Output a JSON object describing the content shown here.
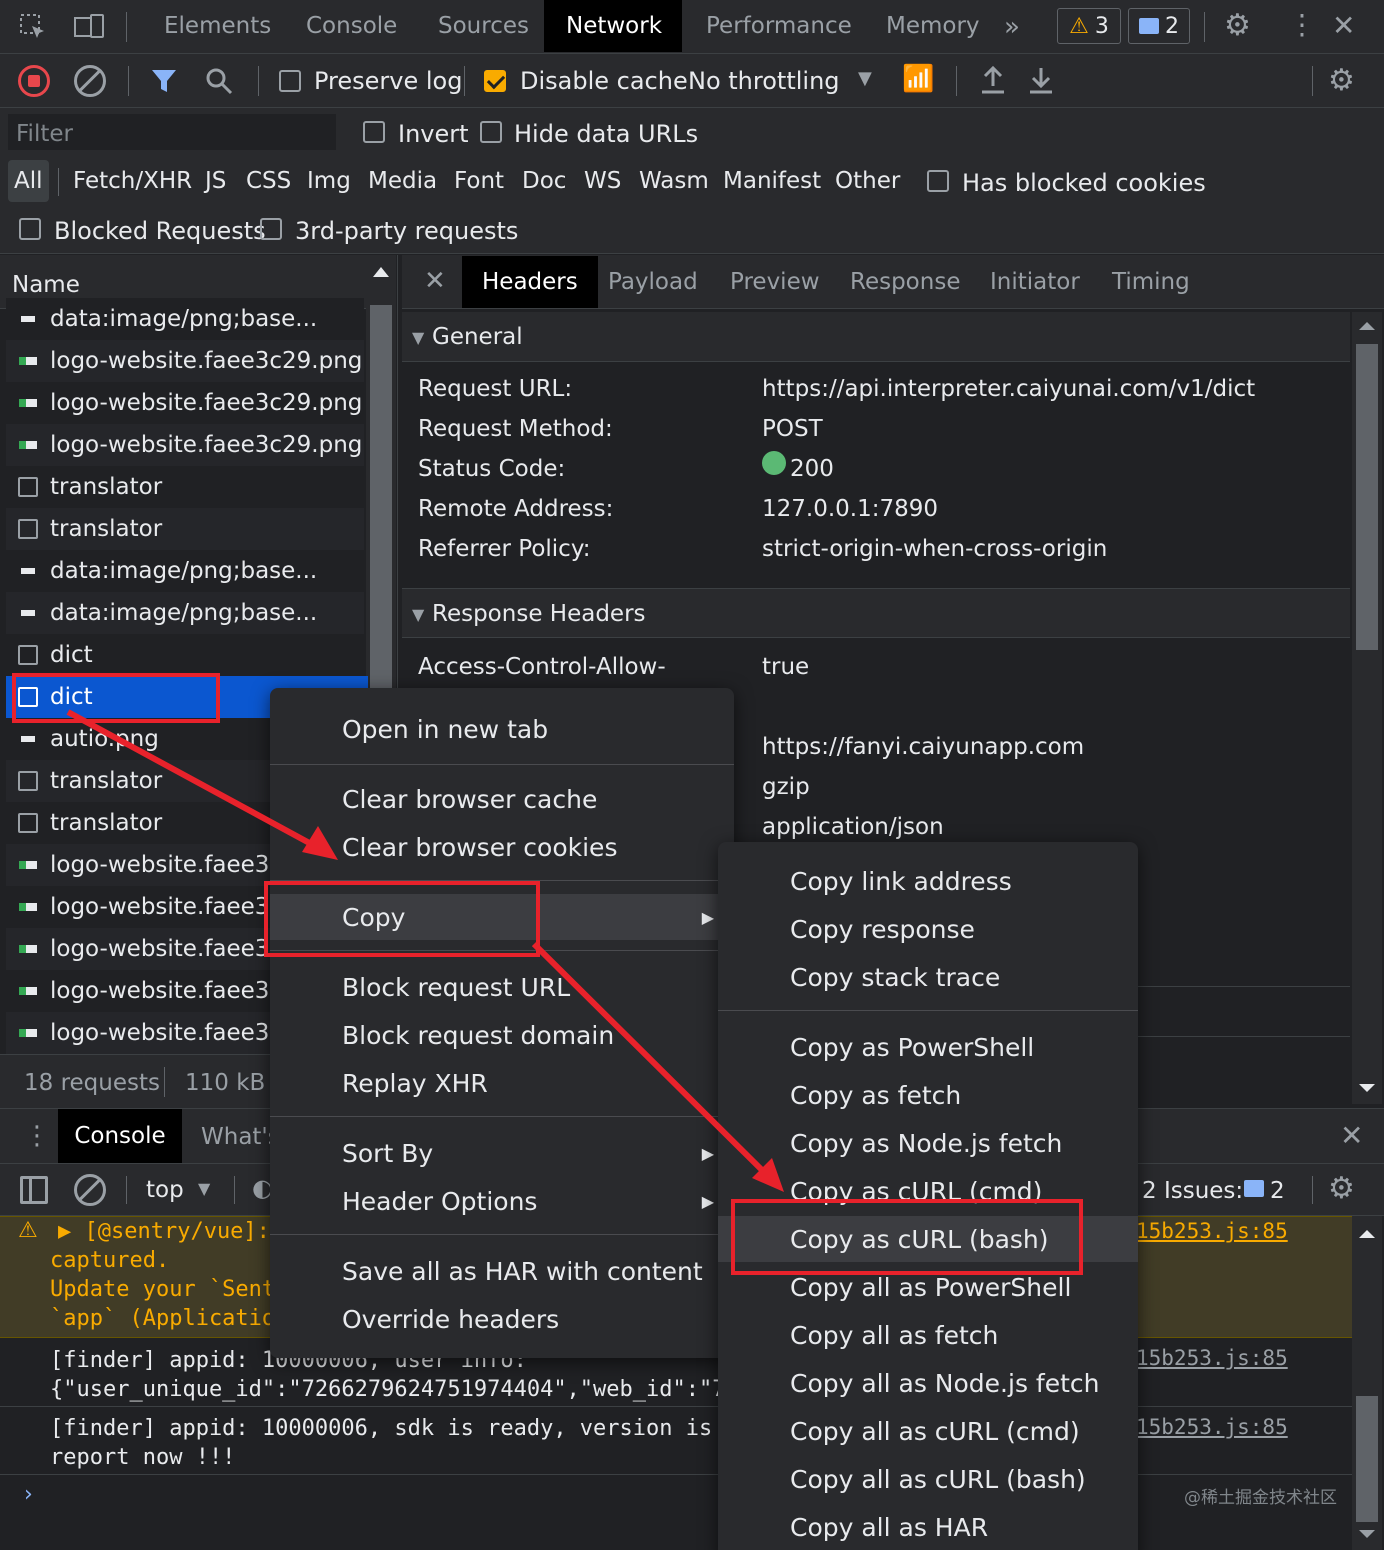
{
  "top_tabs": [
    "Elements",
    "Console",
    "Sources",
    "Network",
    "Performance",
    "Memory"
  ],
  "top_badges": {
    "warnings": "3",
    "messages": "2"
  },
  "toolbar": {
    "preserve_log": "Preserve log",
    "disable_cache": "Disable cache",
    "throttling": "No throttling"
  },
  "filter": {
    "placeholder": "Filter",
    "invert": "Invert",
    "hide_data_urls": "Hide data URLs",
    "has_blocked_cookies": "Has blocked cookies",
    "blocked_requests": "Blocked Requests",
    "third_party": "3rd-party requests"
  },
  "type_filters": [
    "All",
    "Fetch/XHR",
    "JS",
    "CSS",
    "Img",
    "Media",
    "Font",
    "Doc",
    "WS",
    "Wasm",
    "Manifest",
    "Other"
  ],
  "request_list": {
    "header": "Name",
    "rows": [
      {
        "name": "data:image/png;base...",
        "icon": "image-icon"
      },
      {
        "name": "logo-website.faee3c29.png",
        "icon": "png-icon"
      },
      {
        "name": "logo-website.faee3c29.png",
        "icon": "png-icon"
      },
      {
        "name": "logo-website.faee3c29.png",
        "icon": "png-icon"
      },
      {
        "name": "translator",
        "icon": "document-icon"
      },
      {
        "name": "translator",
        "icon": "document-icon"
      },
      {
        "name": "data:image/png;base...",
        "icon": "image-icon"
      },
      {
        "name": "data:image/png;base...",
        "icon": "image-icon"
      },
      {
        "name": "dict",
        "icon": "document-icon"
      },
      {
        "name": "dict",
        "icon": "document-icon"
      },
      {
        "name": "autio.png",
        "icon": "image-icon"
      },
      {
        "name": "translator",
        "icon": "document-icon"
      },
      {
        "name": "translator",
        "icon": "document-icon"
      },
      {
        "name": "logo-website.faee3c29.png",
        "icon": "png-icon"
      },
      {
        "name": "logo-website.faee3c29.png",
        "icon": "png-icon"
      },
      {
        "name": "logo-website.faee3c29.png",
        "icon": "png-icon"
      },
      {
        "name": "logo-website.faee3c29.png",
        "icon": "png-icon"
      },
      {
        "name": "logo-website.faee3c29.png",
        "icon": "png-icon"
      }
    ],
    "summary_requests": "18 requests",
    "summary_size": "110 kB t"
  },
  "detail_tabs": [
    "Headers",
    "Payload",
    "Preview",
    "Response",
    "Initiator",
    "Timing"
  ],
  "general": {
    "title": "General",
    "rows": [
      {
        "key": "Request URL:",
        "value": "https://api.interpreter.caiyunai.com/v1/dict"
      },
      {
        "key": "Request Method:",
        "value": "POST"
      },
      {
        "key": "Status Code:",
        "value": "200"
      },
      {
        "key": "Remote Address:",
        "value": "127.0.0.1:7890"
      },
      {
        "key": "Referrer Policy:",
        "value": "strict-origin-when-cross-origin"
      }
    ]
  },
  "response_headers": {
    "title": "Response Headers",
    "first_key": "Access-Control-Allow-",
    "values": [
      "true",
      "https://fanyi.caiyunapp.com",
      "gzip",
      "application/json"
    ]
  },
  "context_menu": {
    "group1": [
      "Open in new tab"
    ],
    "group2": [
      "Clear browser cache",
      "Clear browser cookies"
    ],
    "group3": [
      "Copy"
    ],
    "group4": [
      "Block request URL",
      "Block request domain",
      "Replay XHR"
    ],
    "group5": [
      "Sort By",
      "Header Options"
    ],
    "group6": [
      "Save all as HAR with content",
      "Override headers"
    ]
  },
  "copy_submenu": {
    "group1": [
      "Copy link address",
      "Copy response",
      "Copy stack trace"
    ],
    "group2": [
      "Copy as PowerShell",
      "Copy as fetch",
      "Copy as Node.js fetch",
      "Copy as cURL (cmd)",
      "Copy as cURL (bash)",
      "Copy all as PowerShell",
      "Copy all as fetch",
      "Copy all as Node.js fetch",
      "Copy all as cURL (cmd)",
      "Copy all as cURL (bash)",
      "Copy all as HAR"
    ]
  },
  "drawer": {
    "tabs": [
      "Console",
      "What's"
    ],
    "context": "top",
    "issues_label": "2 Issues:",
    "issues_count": "2",
    "messages": [
      {
        "lines": [
          "▶ [@sentry/vue]:",
          "captured.",
          "Update your `Sent",
          "`app` (Applicatio"
        ],
        "source": "15b253.js:85"
      },
      {
        "lines": [
          "[finder] appid: 10000006, user info:",
          "{\"user_unique_id\":\"7266279624751974404\",\"web_id\":\"7"
        ],
        "source": "15b253.js:85"
      },
      {
        "lines": [
          "[finder] appid: 10000006, sdk is ready, version is",
          "report now !!!"
        ],
        "source": "15b253.js:85"
      }
    ]
  },
  "watermark": "@稀土掘金技术社区",
  "colors": {
    "accent_red": "#e8222b",
    "selected_row": "#0b57d0",
    "status_green": "#5bb974",
    "warning_bg": "#413c26",
    "warning_text": "#f9ab00"
  }
}
